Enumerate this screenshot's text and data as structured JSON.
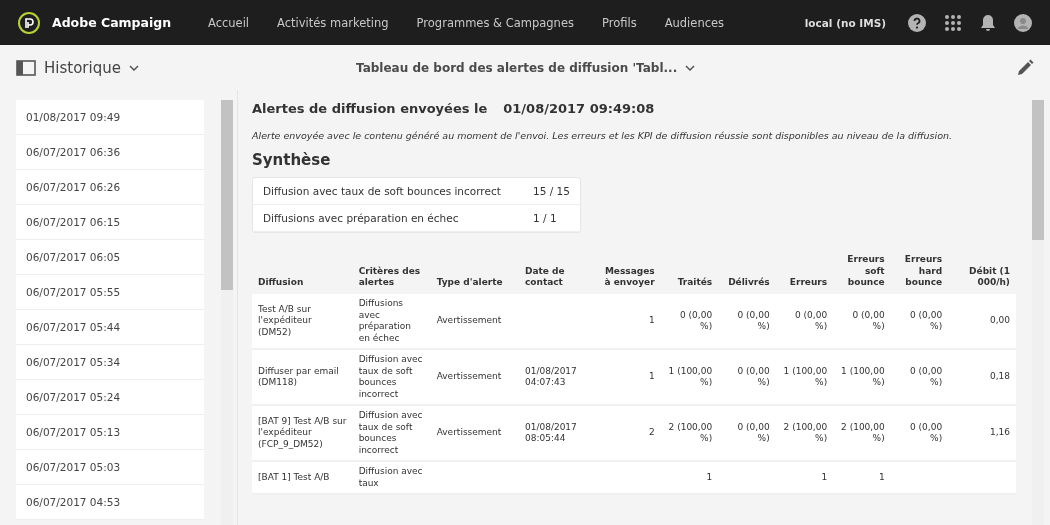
{
  "topbar": {
    "brand": "Adobe Campaign",
    "nav": [
      {
        "label": "Accueil",
        "selected": false
      },
      {
        "label": "Activités marketing",
        "selected": false
      },
      {
        "label": "Programmes & Campagnes",
        "selected": false
      },
      {
        "label": "Profils",
        "selected": false
      },
      {
        "label": "Audiences",
        "selected": false
      }
    ],
    "instance": "local (no IMS)"
  },
  "subheader": {
    "section": "Historique",
    "title": "Tableau de bord des alertes de diffusion 'Tabl..."
  },
  "history": [
    "01/08/2017 09:49",
    "06/07/2017 06:36",
    "06/07/2017 06:26",
    "06/07/2017 06:15",
    "06/07/2017 06:05",
    "06/07/2017 05:55",
    "06/07/2017 05:44",
    "06/07/2017 05:34",
    "06/07/2017 05:24",
    "06/07/2017 05:13",
    "06/07/2017 05:03",
    "06/07/2017 04:53"
  ],
  "report": {
    "heading": "Alertes de diffusion envoyées le",
    "date": "01/08/2017 09:49:08",
    "note": "Alerte envoyée avec le contenu généré au moment de l'envoi. Les erreurs et les KPI de diffusion réussie sont disponibles au niveau de la diffusion.",
    "summary_title": "Synthèse",
    "summary": [
      {
        "label": "Diffusion avec taux de soft bounces incorrect",
        "value": "15 / 15"
      },
      {
        "label": "Diffusions avec préparation en échec",
        "value": "1 / 1"
      }
    ],
    "table": {
      "columns": [
        "Diffusion",
        "Critères des alertes",
        "Type d'alerte",
        "Date de contact",
        "Messages à envoyer",
        "Traités",
        "Délivrés",
        "Erreurs",
        "Erreurs soft bounce",
        "Erreurs hard bounce",
        "Débit (1 000/h)"
      ],
      "rows": [
        [
          "Test A/B sur l'expéditeur (DM52)",
          "Diffusions avec préparation en échec",
          "Avertissement",
          "",
          "1",
          "0 (0,00 %)",
          "0 (0,00 %)",
          "0 (0,00 %)",
          "0 (0,00 %)",
          "0 (0,00 %)",
          "0,00"
        ],
        [
          "Diffuser par email (DM118)",
          "Diffusion avec taux de soft bounces incorrect",
          "Avertissement",
          "01/08/2017 04:07:43",
          "1",
          "1 (100,00 %)",
          "0 (0,00 %)",
          "1 (100,00 %)",
          "1 (100,00 %)",
          "0 (0,00 %)",
          "0,18"
        ],
        [
          "[BAT 9] Test A/B sur l'expéditeur (FCP_9_DM52)",
          "Diffusion avec taux de soft bounces incorrect",
          "Avertissement",
          "01/08/2017 08:05:44",
          "2",
          "2 (100,00 %)",
          "0 (0,00 %)",
          "2 (100,00 %)",
          "2 (100,00 %)",
          "0 (0,00 %)",
          "1,16"
        ],
        [
          "[BAT 1] Test A/B",
          "Diffusion avec taux",
          "",
          "",
          "",
          "1",
          "",
          "1",
          "1",
          "",
          ""
        ]
      ]
    }
  }
}
